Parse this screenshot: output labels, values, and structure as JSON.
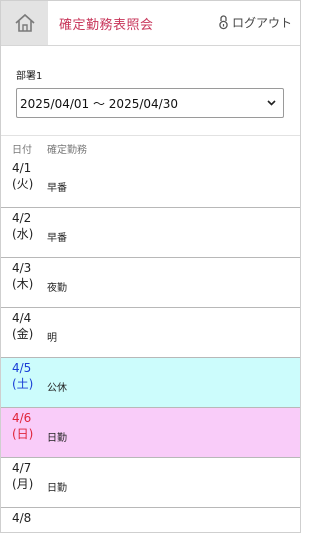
{
  "header": {
    "title": "確定勤務表照会",
    "logout_label": "ログアウト"
  },
  "filter": {
    "department_label": "部署1",
    "period_value": "2025/04/01 ～ 2025/04/30"
  },
  "table": {
    "col_date": "日付",
    "col_duty": "確定勤務",
    "rows": [
      {
        "date": "4/1",
        "dow": "(火)",
        "duty": "早番",
        "kind": "weekday"
      },
      {
        "date": "4/2",
        "dow": "(水)",
        "duty": "早番",
        "kind": "weekday"
      },
      {
        "date": "4/3",
        "dow": "(木)",
        "duty": "夜勤",
        "kind": "weekday"
      },
      {
        "date": "4/4",
        "dow": "(金)",
        "duty": "明",
        "kind": "weekday"
      },
      {
        "date": "4/5",
        "dow": "(土)",
        "duty": "公休",
        "kind": "saturday"
      },
      {
        "date": "4/6",
        "dow": "(日)",
        "duty": "日勤",
        "kind": "sunday"
      },
      {
        "date": "4/7",
        "dow": "(月)",
        "duty": "日勤",
        "kind": "weekday"
      },
      {
        "date": "4/8",
        "dow": "",
        "duty": "",
        "kind": "weekday"
      }
    ]
  },
  "colors": {
    "title": "#c8375b",
    "saturday_bg": "#ccfcfc",
    "sunday_bg": "#f9ccf9",
    "saturday_text": "#1a3fd6",
    "sunday_text": "#e0243a"
  },
  "icons": {
    "home": "home-icon",
    "logout": "lock-icon",
    "select": "chevron-down-icon"
  }
}
